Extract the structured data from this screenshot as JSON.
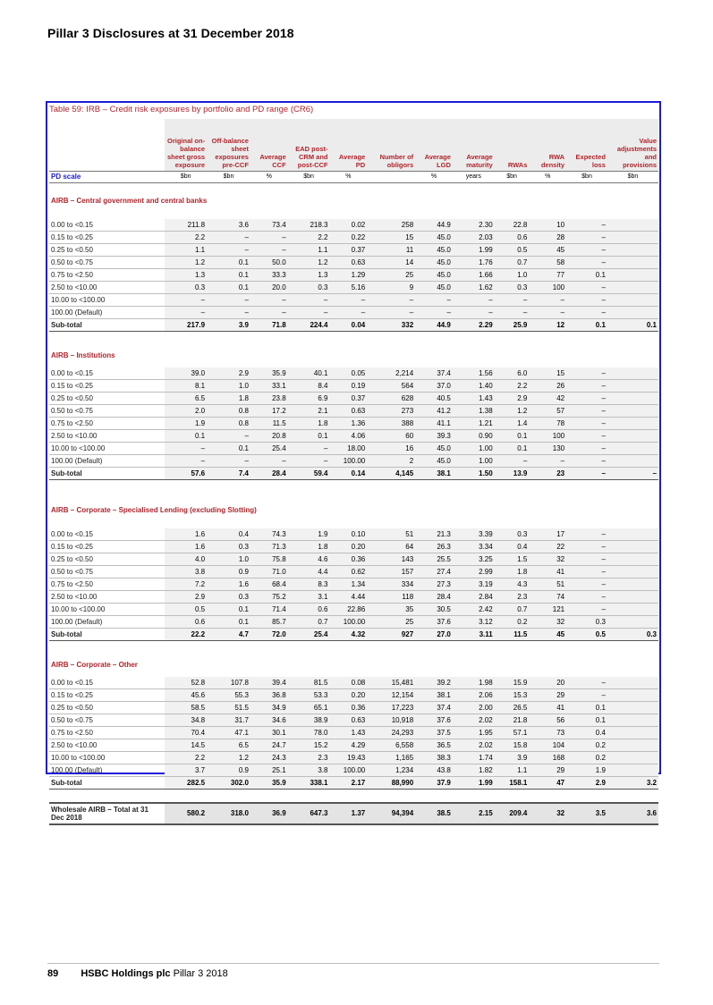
{
  "page": {
    "header": "Pillar 3 Disclosures at 31 December 2018",
    "footer_page": "89",
    "footer_company": "HSBC Holdings plc",
    "footer_doc": "Pillar 3 2018"
  },
  "table": {
    "title": "Table 59: IRB – Credit risk exposures by portfolio and PD range (CR6)",
    "columns": [
      "Original on-balance sheet gross exposure",
      "Off-balance sheet exposures pre-CCF",
      "Average CCF",
      "EAD post-CRM and post-CCF",
      "Average PD",
      "Number of obligors",
      "Average LGD",
      "Average maturity",
      "RWAs",
      "RWA density",
      "Expected loss",
      "Value adjustments and provisions"
    ],
    "units_label": "PD scale",
    "units": [
      "$bn",
      "$bn",
      "%",
      "$bn",
      "%",
      "",
      "%",
      "years",
      "$bn",
      "%",
      "$bn",
      "$bn"
    ],
    "pd_bands": [
      "0.00 to <0.15",
      "0.15 to <0.25",
      "0.25 to <0.50",
      "0.50 to <0.75",
      "0.75 to <2.50",
      "2.50 to <10.00",
      "10.00 to <100.00",
      "100.00 (Default)"
    ],
    "subtotal_label": "Sub-total",
    "sections": [
      {
        "title": "AIRB – Central government and central banks",
        "rows": [
          [
            "211.8",
            "3.6",
            "73.4",
            "218.3",
            "0.02",
            "258",
            "44.9",
            "2.30",
            "22.8",
            "10",
            "–",
            ""
          ],
          [
            "2.2",
            "–",
            "–",
            "2.2",
            "0.22",
            "15",
            "45.0",
            "2.03",
            "0.6",
            "28",
            "–",
            ""
          ],
          [
            "1.1",
            "–",
            "–",
            "1.1",
            "0.37",
            "11",
            "45.0",
            "1.99",
            "0.5",
            "45",
            "–",
            ""
          ],
          [
            "1.2",
            "0.1",
            "50.0",
            "1.2",
            "0.63",
            "14",
            "45.0",
            "1.76",
            "0.7",
            "58",
            "–",
            ""
          ],
          [
            "1.3",
            "0.1",
            "33.3",
            "1.3",
            "1.29",
            "25",
            "45.0",
            "1.66",
            "1.0",
            "77",
            "0.1",
            ""
          ],
          [
            "0.3",
            "0.1",
            "20.0",
            "0.3",
            "5.16",
            "9",
            "45.0",
            "1.62",
            "0.3",
            "100",
            "–",
            ""
          ],
          [
            "–",
            "–",
            "–",
            "–",
            "–",
            "–",
            "–",
            "–",
            "–",
            "–",
            "–",
            ""
          ],
          [
            "–",
            "–",
            "–",
            "–",
            "–",
            "–",
            "–",
            "–",
            "–",
            "–",
            "–",
            ""
          ]
        ],
        "subtotal": [
          "217.9",
          "3.9",
          "71.8",
          "224.4",
          "0.04",
          "332",
          "44.9",
          "2.29",
          "25.9",
          "12",
          "0.1",
          "0.1"
        ]
      },
      {
        "title": "AIRB – Institutions",
        "rows": [
          [
            "39.0",
            "2.9",
            "35.9",
            "40.1",
            "0.05",
            "2,214",
            "37.4",
            "1.56",
            "6.0",
            "15",
            "–",
            ""
          ],
          [
            "8.1",
            "1.0",
            "33.1",
            "8.4",
            "0.19",
            "564",
            "37.0",
            "1.40",
            "2.2",
            "26",
            "–",
            ""
          ],
          [
            "6.5",
            "1.8",
            "23.8",
            "6.9",
            "0.37",
            "628",
            "40.5",
            "1.43",
            "2.9",
            "42",
            "–",
            ""
          ],
          [
            "2.0",
            "0.8",
            "17.2",
            "2.1",
            "0.63",
            "273",
            "41.2",
            "1.38",
            "1.2",
            "57",
            "–",
            ""
          ],
          [
            "1.9",
            "0.8",
            "11.5",
            "1.8",
            "1.36",
            "388",
            "41.1",
            "1.21",
            "1.4",
            "78",
            "–",
            ""
          ],
          [
            "0.1",
            "–",
            "20.8",
            "0.1",
            "4.06",
            "60",
            "39.3",
            "0.90",
            "0.1",
            "100",
            "–",
            ""
          ],
          [
            "–",
            "0.1",
            "25.4",
            "–",
            "18.00",
            "16",
            "45.0",
            "1.00",
            "0.1",
            "130",
            "–",
            ""
          ],
          [
            "–",
            "–",
            "–",
            "–",
            "100.00",
            "2",
            "45.0",
            "1.00",
            "–",
            "–",
            "–",
            ""
          ]
        ],
        "subtotal": [
          "57.6",
          "7.4",
          "28.4",
          "59.4",
          "0.14",
          "4,145",
          "38.1",
          "1.50",
          "13.9",
          "23",
          "–",
          "–"
        ]
      },
      {
        "title": "AIRB – Corporate – Specialised Lending (excluding Slotting)",
        "rows": [
          [
            "1.6",
            "0.4",
            "74.3",
            "1.9",
            "0.10",
            "51",
            "21.3",
            "3.39",
            "0.3",
            "17",
            "–",
            ""
          ],
          [
            "1.6",
            "0.3",
            "71.3",
            "1.8",
            "0.20",
            "64",
            "26.3",
            "3.34",
            "0.4",
            "22",
            "–",
            ""
          ],
          [
            "4.0",
            "1.0",
            "75.8",
            "4.6",
            "0.36",
            "143",
            "25.5",
            "3.25",
            "1.5",
            "32",
            "–",
            ""
          ],
          [
            "3.8",
            "0.9",
            "71.0",
            "4.4",
            "0.62",
            "157",
            "27.4",
            "2.99",
            "1.8",
            "41",
            "–",
            ""
          ],
          [
            "7.2",
            "1.6",
            "68.4",
            "8.3",
            "1.34",
            "334",
            "27.3",
            "3.19",
            "4.3",
            "51",
            "–",
            ""
          ],
          [
            "2.9",
            "0.3",
            "75.2",
            "3.1",
            "4.44",
            "118",
            "28.4",
            "2.84",
            "2.3",
            "74",
            "–",
            ""
          ],
          [
            "0.5",
            "0.1",
            "71.4",
            "0.6",
            "22.86",
            "35",
            "30.5",
            "2.42",
            "0.7",
            "121",
            "–",
            ""
          ],
          [
            "0.6",
            "0.1",
            "85.7",
            "0.7",
            "100.00",
            "25",
            "37.6",
            "3.12",
            "0.2",
            "32",
            "0.3",
            ""
          ]
        ],
        "subtotal": [
          "22.2",
          "4.7",
          "72.0",
          "25.4",
          "4.32",
          "927",
          "27.0",
          "3.11",
          "11.5",
          "45",
          "0.5",
          "0.3"
        ]
      },
      {
        "title": "AIRB – Corporate – Other",
        "rows": [
          [
            "52.8",
            "107.8",
            "39.4",
            "81.5",
            "0.08",
            "15,481",
            "39.2",
            "1.98",
            "15.9",
            "20",
            "–",
            ""
          ],
          [
            "45.6",
            "55.3",
            "36.8",
            "53.3",
            "0.20",
            "12,154",
            "38.1",
            "2.06",
            "15.3",
            "29",
            "–",
            ""
          ],
          [
            "58.5",
            "51.5",
            "34.9",
            "65.1",
            "0.36",
            "17,223",
            "37.4",
            "2.00",
            "26.5",
            "41",
            "0.1",
            ""
          ],
          [
            "34.8",
            "31.7",
            "34.6",
            "38.9",
            "0.63",
            "10,918",
            "37.6",
            "2.02",
            "21.8",
            "56",
            "0.1",
            ""
          ],
          [
            "70.4",
            "47.1",
            "30.1",
            "78.0",
            "1.43",
            "24,293",
            "37.5",
            "1.95",
            "57.1",
            "73",
            "0.4",
            ""
          ],
          [
            "14.5",
            "6.5",
            "24.7",
            "15.2",
            "4.29",
            "6,558",
            "36.5",
            "2.02",
            "15.8",
            "104",
            "0.2",
            ""
          ],
          [
            "2.2",
            "1.2",
            "24.3",
            "2.3",
            "19.43",
            "1,165",
            "38.3",
            "1.74",
            "3.9",
            "168",
            "0.2",
            ""
          ],
          [
            "3.7",
            "0.9",
            "25.1",
            "3.8",
            "100.00",
            "1,234",
            "43.8",
            "1.82",
            "1.1",
            "29",
            "1.9",
            ""
          ]
        ],
        "subtotal": [
          "282.5",
          "302.0",
          "35.9",
          "338.1",
          "2.17",
          "88,990",
          "37.9",
          "1.99",
          "158.1",
          "47",
          "2.9",
          "3.2"
        ]
      }
    ],
    "total": {
      "label": "Wholesale AIRB – Total at 31 Dec 2018",
      "values": [
        "580.2",
        "318.0",
        "36.9",
        "647.3",
        "1.37",
        "94,394",
        "38.5",
        "2.15",
        "209.4",
        "32",
        "3.5",
        "3.6"
      ]
    }
  }
}
